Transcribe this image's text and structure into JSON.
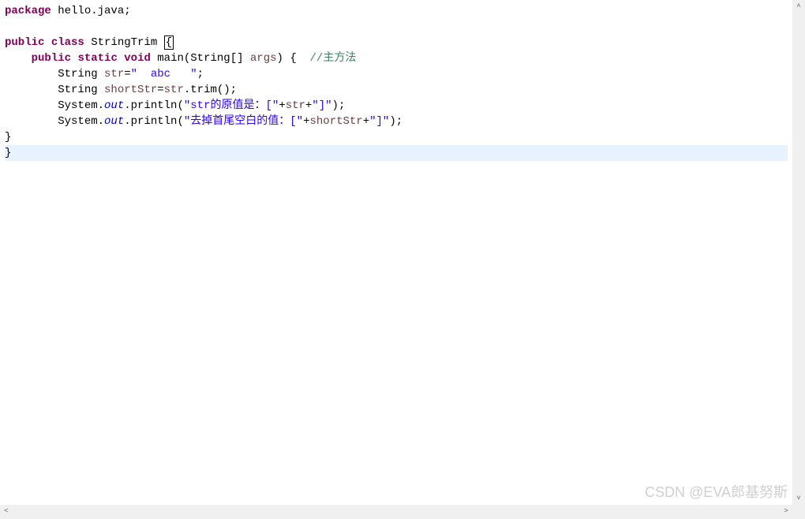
{
  "code": {
    "lines": [
      {
        "indent": "",
        "tokens": [
          {
            "t": "kw",
            "v": "package"
          },
          {
            "t": "plain",
            "v": " hello.java;"
          }
        ]
      },
      {
        "indent": "",
        "tokens": []
      },
      {
        "indent": "",
        "tokens": [
          {
            "t": "kw",
            "v": "public"
          },
          {
            "t": "plain",
            "v": " "
          },
          {
            "t": "kw",
            "v": "class"
          },
          {
            "t": "plain",
            "v": " StringTrim "
          },
          {
            "t": "cursor",
            "v": "{"
          }
        ]
      },
      {
        "indent": "    ",
        "tokens": [
          {
            "t": "kw",
            "v": "public"
          },
          {
            "t": "plain",
            "v": " "
          },
          {
            "t": "kw",
            "v": "static"
          },
          {
            "t": "plain",
            "v": " "
          },
          {
            "t": "kw",
            "v": "void"
          },
          {
            "t": "plain",
            "v": " main(String[] "
          },
          {
            "t": "var",
            "v": "args"
          },
          {
            "t": "plain",
            "v": ") {  "
          },
          {
            "t": "comment",
            "v": "//主方法"
          }
        ]
      },
      {
        "indent": "        ",
        "tokens": [
          {
            "t": "plain",
            "v": "String "
          },
          {
            "t": "var",
            "v": "str"
          },
          {
            "t": "plain",
            "v": "="
          },
          {
            "t": "str",
            "v": "\"  abc   \""
          },
          {
            "t": "plain",
            "v": ";"
          }
        ]
      },
      {
        "indent": "        ",
        "tokens": [
          {
            "t": "plain",
            "v": "String "
          },
          {
            "t": "var",
            "v": "shortStr"
          },
          {
            "t": "plain",
            "v": "="
          },
          {
            "t": "var",
            "v": "str"
          },
          {
            "t": "plain",
            "v": ".trim();"
          }
        ]
      },
      {
        "indent": "        ",
        "tokens": [
          {
            "t": "plain",
            "v": "System."
          },
          {
            "t": "field",
            "v": "out"
          },
          {
            "t": "plain",
            "v": ".println("
          },
          {
            "t": "str",
            "v": "\"str的原值是：[\""
          },
          {
            "t": "plain",
            "v": "+"
          },
          {
            "t": "var",
            "v": "str"
          },
          {
            "t": "plain",
            "v": "+"
          },
          {
            "t": "str",
            "v": "\"]\""
          },
          {
            "t": "plain",
            "v": ");"
          }
        ]
      },
      {
        "indent": "        ",
        "tokens": [
          {
            "t": "plain",
            "v": "System."
          },
          {
            "t": "field",
            "v": "out"
          },
          {
            "t": "plain",
            "v": ".println("
          },
          {
            "t": "str",
            "v": "\"去掉首尾空白的值：[\""
          },
          {
            "t": "plain",
            "v": "+"
          },
          {
            "t": "var",
            "v": "shortStr"
          },
          {
            "t": "plain",
            "v": "+"
          },
          {
            "t": "str",
            "v": "\"]\""
          },
          {
            "t": "plain",
            "v": ");"
          }
        ]
      },
      {
        "indent": "",
        "tokens": [
          {
            "t": "plain",
            "v": "}"
          }
        ]
      },
      {
        "indent": "",
        "tokens": [
          {
            "t": "plain",
            "v": "}"
          }
        ],
        "highlight": true
      }
    ]
  },
  "watermark": "CSDN @EVA郎基努斯",
  "scrollbar": {
    "up": "˄",
    "down": "˅",
    "left": "˂",
    "right": "˃"
  }
}
